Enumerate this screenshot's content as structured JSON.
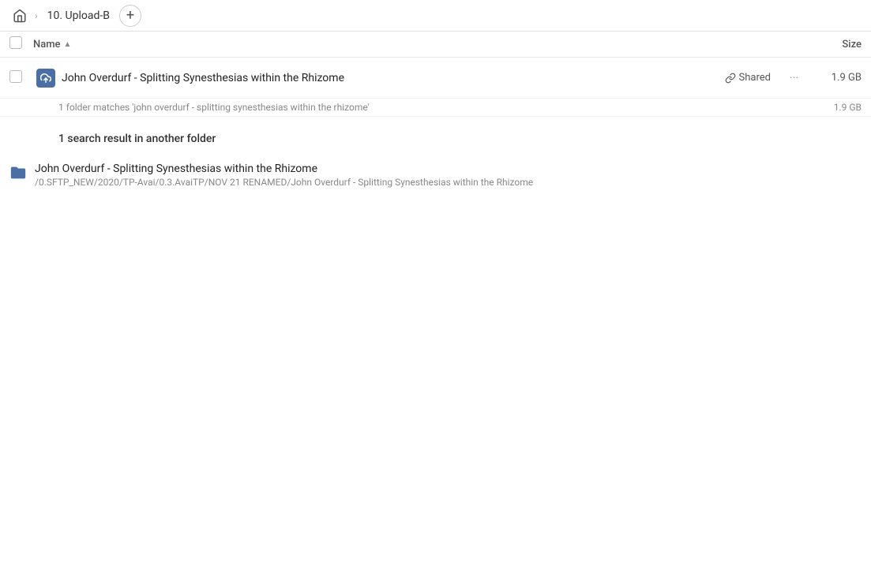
{
  "topbar": {
    "home_icon": "home",
    "breadcrumb_sep": "›",
    "folder_name": "10. Upload-B",
    "add_btn": "+"
  },
  "columns": {
    "name_label": "Name",
    "sort_icon": "▲",
    "size_label": "Size"
  },
  "primary_result": {
    "icon_type": "upload",
    "name": "John Overdurf - Splitting Synesthesias within the Rhizome",
    "shared_label": "Shared",
    "actions_icon": "···",
    "size": "1.9 GB",
    "match_text": "1 folder matches 'john overdurf - splitting synesthesias within the rhizome'",
    "match_size": "1.9 GB"
  },
  "section": {
    "heading": "1 search result in another folder"
  },
  "folder_results": [
    {
      "name": "John Overdurf - Splitting Synesthesias within the Rhizome",
      "path": "/0.SFTP_NEW/2020/TP-Avai/0.3.AvaiTP/NOV 21 RENAMED/John Overdurf - Splitting Synesthesias within the Rhizome"
    }
  ],
  "colors": {
    "accent": "#4a6fa5",
    "shared_link": "#555",
    "muted": "#888"
  }
}
